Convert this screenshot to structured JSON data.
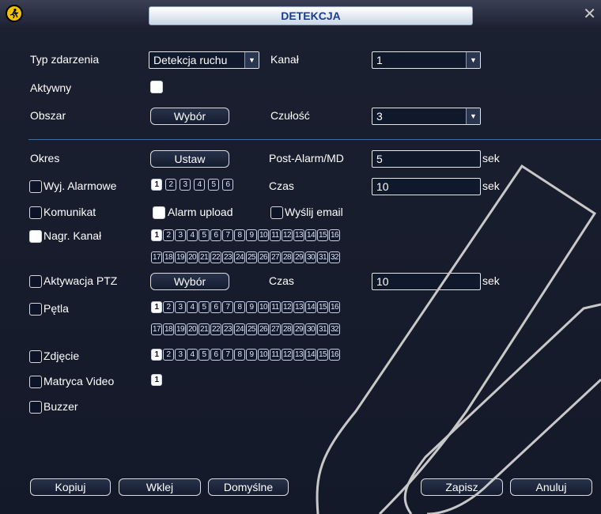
{
  "window": {
    "title": "DETEKCJA",
    "logo_icon": "running-man-icon",
    "close_icon": "close-icon"
  },
  "event_type": {
    "label": "Typ zdarzenia",
    "value": "Detekcja ruchu"
  },
  "channel": {
    "label": "Kanał",
    "value": "1"
  },
  "active": {
    "label": "Aktywny",
    "checked": true
  },
  "area": {
    "label": "Obszar",
    "button": "Wybór"
  },
  "sensitivity": {
    "label": "Czułość",
    "value": "3"
  },
  "period": {
    "label": "Okres",
    "button": "Ustaw"
  },
  "post_alarm": {
    "label": "Post-Alarm/MD",
    "value": "5",
    "unit": "sek"
  },
  "alarm_out": {
    "label": "Wyj. Alarmowe",
    "checked": false,
    "channels": [
      "1",
      "2",
      "3",
      "4",
      "5",
      "6"
    ],
    "selected": [
      "1"
    ]
  },
  "alarm_time": {
    "label": "Czas",
    "value": "10",
    "unit": "sek"
  },
  "message": {
    "label": "Komunikat",
    "checked": false
  },
  "alarm_upload": {
    "label": "Alarm upload",
    "checked": true
  },
  "send_email": {
    "label": "Wyślij email",
    "checked": false
  },
  "record_channel": {
    "label": "Nagr. Kanał",
    "checked": true,
    "row1": [
      "1",
      "2",
      "3",
      "4",
      "5",
      "6",
      "7",
      "8",
      "9",
      "10",
      "11",
      "12",
      "13",
      "14",
      "15",
      "16"
    ],
    "row2": [
      "17",
      "18",
      "19",
      "20",
      "21",
      "22",
      "23",
      "24",
      "25",
      "26",
      "27",
      "28",
      "29",
      "30",
      "31",
      "32"
    ],
    "selected": [
      "1"
    ]
  },
  "ptz": {
    "label": "Aktywacja PTZ",
    "checked": false,
    "button": "Wybór",
    "time_label": "Czas",
    "value": "10",
    "unit": "sek"
  },
  "tour": {
    "label": "Pętla",
    "checked": false,
    "row1": [
      "1",
      "2",
      "3",
      "4",
      "5",
      "6",
      "7",
      "8",
      "9",
      "10",
      "11",
      "12",
      "13",
      "14",
      "15",
      "16"
    ],
    "row2": [
      "17",
      "18",
      "19",
      "20",
      "21",
      "22",
      "23",
      "24",
      "25",
      "26",
      "27",
      "28",
      "29",
      "30",
      "31",
      "32"
    ],
    "selected": [
      "1"
    ]
  },
  "snapshot": {
    "label": "Zdjęcie",
    "checked": false,
    "row1": [
      "1",
      "2",
      "3",
      "4",
      "5",
      "6",
      "7",
      "8",
      "9",
      "10",
      "11",
      "12",
      "13",
      "14",
      "15",
      "16"
    ],
    "selected": [
      "1"
    ]
  },
  "matrix": {
    "label": "Matryca Video",
    "checked": false,
    "channels": [
      "1"
    ],
    "selected": [
      "1"
    ]
  },
  "buzzer": {
    "label": "Buzzer",
    "checked": false
  },
  "footer": {
    "copy": "Kopiuj",
    "paste": "Wklej",
    "default": "Domyślne",
    "save": "Zapisz",
    "cancel": "Anuluj"
  }
}
